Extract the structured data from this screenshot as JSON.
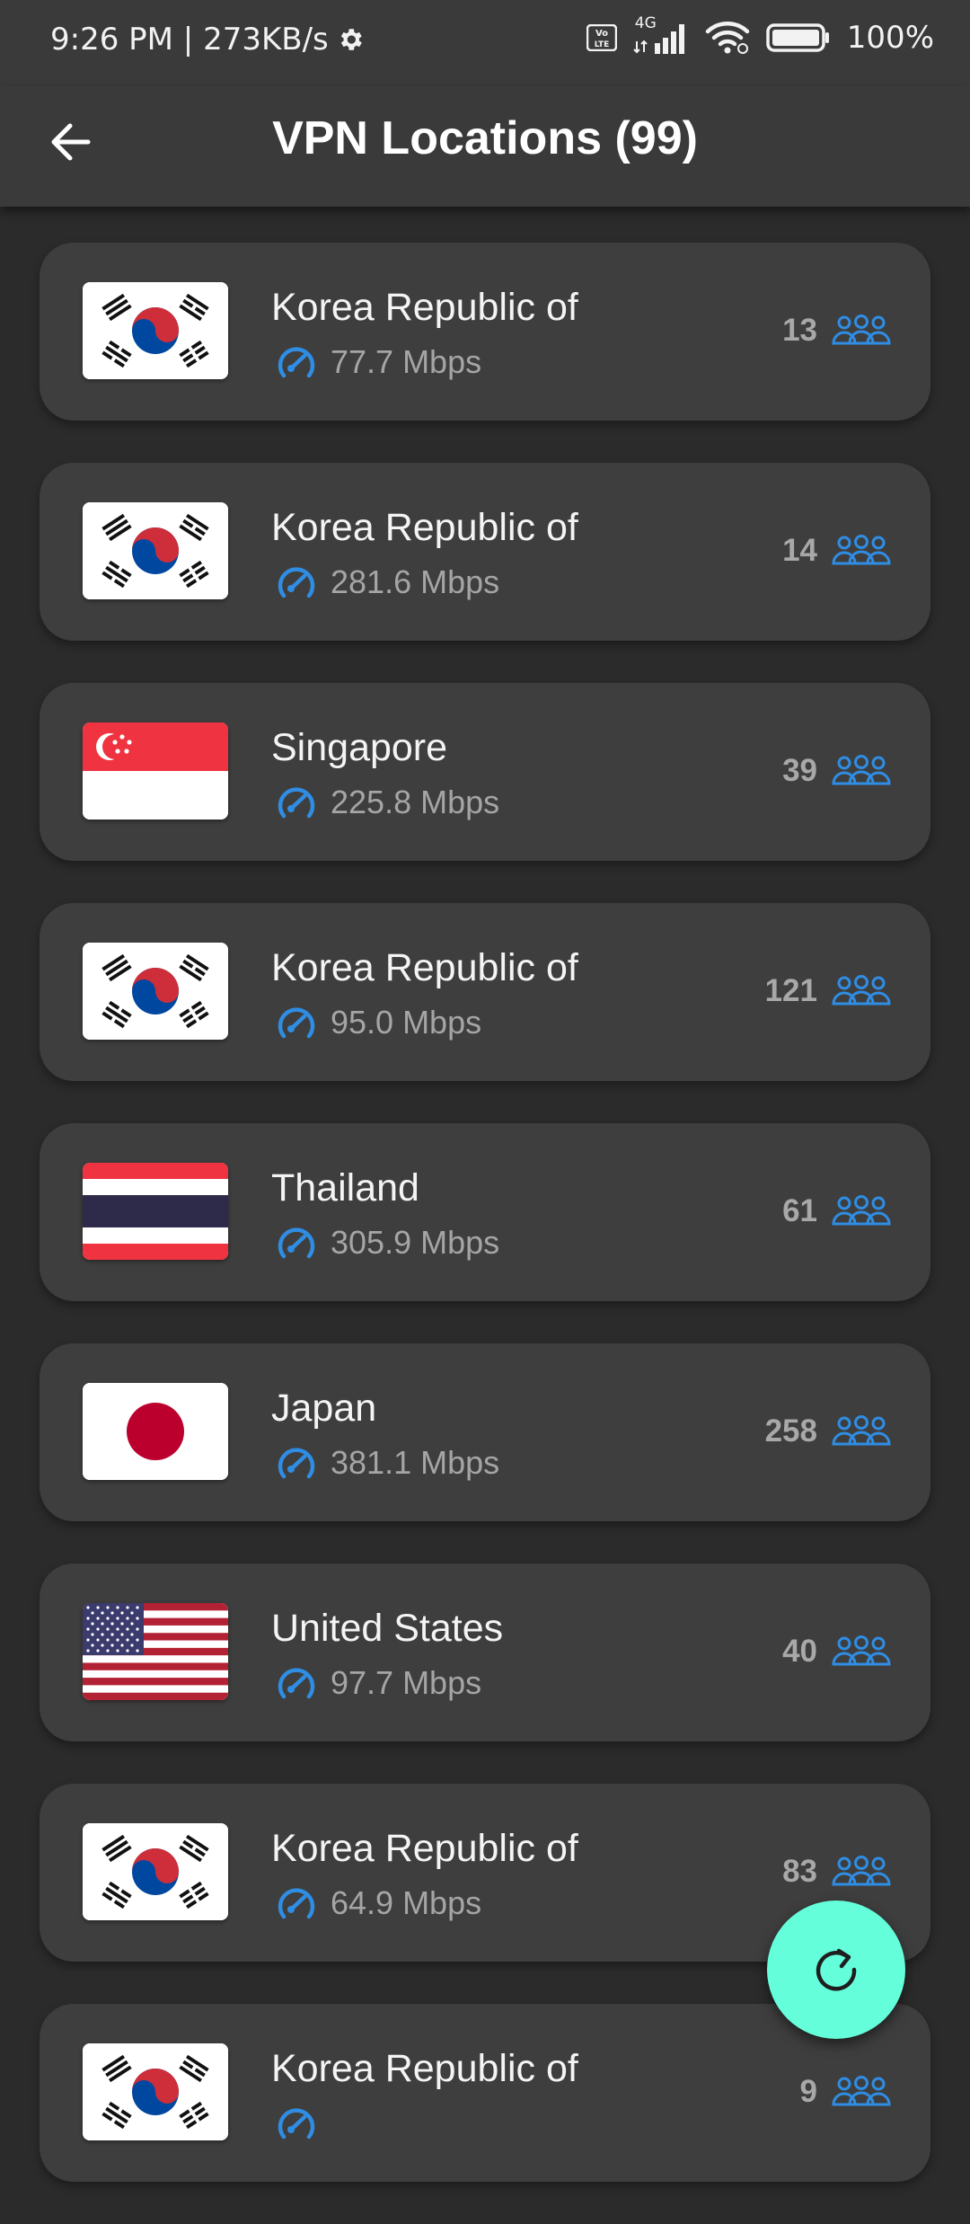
{
  "status_bar": {
    "time_speed": "9:26 PM | 273KB/s",
    "network": "4G",
    "battery": "100%"
  },
  "app_bar": {
    "title": "VPN Locations (99)",
    "back_icon": "arrow-left-icon"
  },
  "servers": [
    {
      "flag": "south-korea",
      "country": "Korea Republic of",
      "speed": "77.7 Mbps",
      "users": "13"
    },
    {
      "flag": "south-korea",
      "country": "Korea Republic of",
      "speed": "281.6 Mbps",
      "users": "14"
    },
    {
      "flag": "singapore",
      "country": "Singapore",
      "speed": "225.8 Mbps",
      "users": "39"
    },
    {
      "flag": "south-korea",
      "country": "Korea Republic of",
      "speed": "95.0 Mbps",
      "users": "121"
    },
    {
      "flag": "thailand",
      "country": "Thailand",
      "speed": "305.9 Mbps",
      "users": "61"
    },
    {
      "flag": "japan",
      "country": "Japan",
      "speed": "381.1 Mbps",
      "users": "258"
    },
    {
      "flag": "united-states",
      "country": "United States",
      "speed": "97.7 Mbps",
      "users": "40"
    },
    {
      "flag": "south-korea",
      "country": "Korea Republic of",
      "speed": "64.9 Mbps",
      "users": "83"
    },
    {
      "flag": "south-korea",
      "country": "Korea Republic of",
      "speed": "",
      "users": "9"
    }
  ],
  "fab": {
    "icon": "refresh-icon"
  },
  "colors": {
    "accent_blue": "#2f8de4",
    "fab": "#64ffda",
    "card": "#3e3e3e",
    "background": "#2b2b2b"
  }
}
